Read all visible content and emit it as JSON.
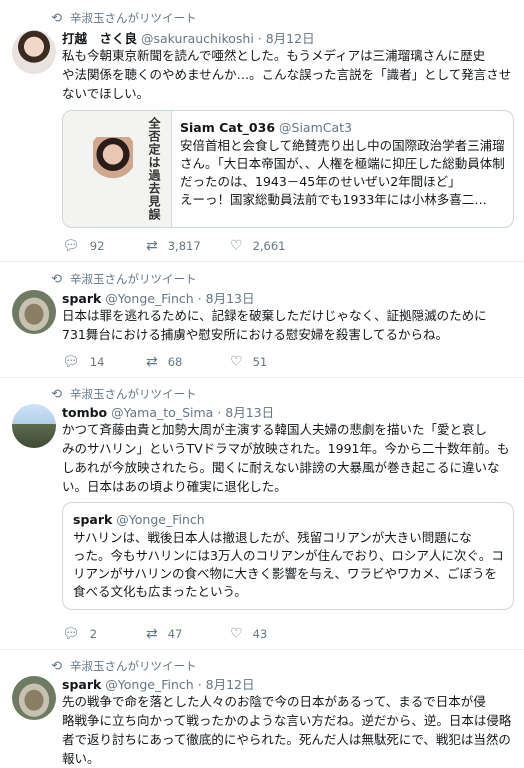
{
  "retweet_label": "辛淑玉さんがリツイート",
  "tweets": [
    {
      "name": "打越　さく良",
      "handle": "@sakurauchikoshi",
      "date": "· 8月12日",
      "lines": [
        "私も今朝東京新聞を読んで唖然とした。もうメディアは三浦瑠璃さんに歴史",
        "や法関係を聴くのやめませんか…。こんな誤った言説を「識者」として発言させ",
        "ないでほしい。"
      ],
      "quote": {
        "name": "Siam Cat_036",
        "handle": "@SiamCat3",
        "lines": [
          "安倍首相と会食して絶賛売り出し中の国際政治学者三浦瑠",
          "さん。「大日本帝国が、、人権を極端に抑圧した総動員体制",
          "だったのは、1943－45年のせいぜい2年間ほど」",
          "えーっ！国家総動員法前でも1933年には小林多喜二…"
        ],
        "image_text": "全否定は過去見誤"
      },
      "replies": "92",
      "retweets": "3,817",
      "likes": "2,661"
    },
    {
      "name": "spark",
      "handle": "@Yonge_Finch",
      "date": "· 8月13日",
      "lines": [
        "日本は罪を逃れるために、記録を破棄しただけじゃなく、証拠隠滅のために",
        "731舞台における捕虜や慰安所における慰安婦を殺害してるからね。"
      ],
      "replies": "14",
      "retweets": "68",
      "likes": "51"
    },
    {
      "name": "tombo",
      "handle": "@Yama_to_Sima",
      "date": "· 8月13日",
      "lines": [
        "かつて斉藤由貴と加勢大周が主演する韓国人夫婦の悲劇を描いた「愛と哀し",
        "みのサハリン」というTVドラマが放映された。1991年。今から二十数年前。も",
        "しあれが今放映されたら。聞くに耐えない誹謗の大暴風が巻き起こるに違いな",
        "い。日本はあの頃より確実に退化した。"
      ],
      "quote": {
        "name": "spark",
        "handle": "@Yonge_Finch",
        "lines": [
          "サハリンは、戦後日本人は撤退したが、残留コリアンが大きい問題にな",
          "った。今もサハリンには3万人のコリアンが住んでおり、ロシア人に次ぐ。コ",
          "リアンがサハリンの食べ物に大きく影響を与え、ワラビやワカメ、ごぼうを",
          "食べる文化も広まったという。"
        ]
      },
      "replies": "2",
      "retweets": "47",
      "likes": "43"
    },
    {
      "name": "spark",
      "handle": "@Yonge_Finch",
      "date": "· 8月12日",
      "lines": [
        "先の戦争で命を落とした人々のお陰で今の日本があるって、まるで日本が侵",
        "略戦争に立ち向かって戦ったかのような言い方だね。逆だから、逆。日本は侵略",
        "者で返り討ちにあって徹底的にやられた。死んだ人は無駄死にで、戦犯は当然の",
        "報い。"
      ]
    }
  ],
  "icons": {
    "reply": "speech-bubble",
    "retweet": "arrows-loop",
    "like": "heart"
  }
}
